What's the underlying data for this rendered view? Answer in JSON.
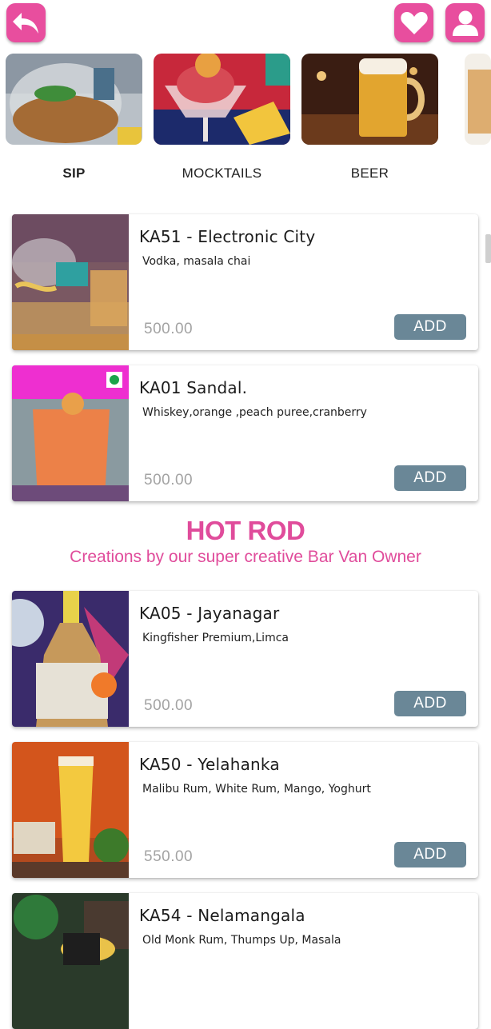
{
  "header": {
    "back_icon": "back-arrow-icon",
    "favorite_icon": "heart-icon",
    "profile_icon": "user-icon",
    "accent_color": "#e84e9e"
  },
  "categories": [
    {
      "label": "SIP",
      "active": true
    },
    {
      "label": "MOCKTAILS",
      "active": false
    },
    {
      "label": "BEER",
      "active": false
    }
  ],
  "items_top": [
    {
      "name": "KA51 - Electronic City",
      "description": "Vodka, masala chai",
      "price": "500.00",
      "button": "ADD"
    },
    {
      "name": "KA01 Sandal.",
      "description": "Whiskey,orange ,peach puree,cranberry",
      "price": "500.00",
      "button": "ADD"
    }
  ],
  "section": {
    "title": "HOT ROD",
    "subtitle": "Creations by our super creative Bar Van Owner",
    "color": "#e04c9b"
  },
  "items_section": [
    {
      "name": "KA05 - Jayanagar",
      "description": "Kingfisher Premium,Limca",
      "price": "500.00",
      "button": "ADD"
    },
    {
      "name": "KA50 - Yelahanka",
      "description": "Malibu Rum, White Rum, Mango, Yoghurt",
      "price": "550.00",
      "button": "ADD"
    },
    {
      "name": "KA54 - Nelamangala",
      "description": "Old Monk Rum, Thumps Up, Masala",
      "price": "",
      "button": ""
    }
  ],
  "colors": {
    "add_button": "#6a8797",
    "price_text": "#a3a3a3"
  }
}
